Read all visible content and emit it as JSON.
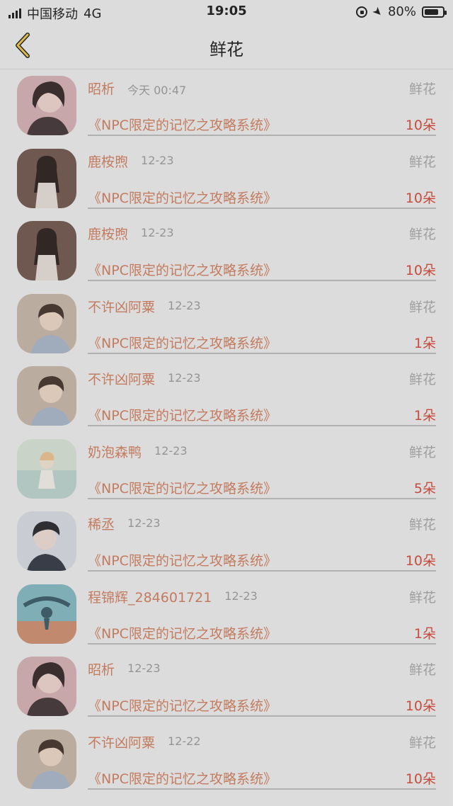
{
  "status": {
    "carrier": "中国移动",
    "network": "4G",
    "time": "19:05",
    "battery_text": "80%",
    "battery_level": 0.8
  },
  "nav": {
    "title": "鲜花",
    "back_icon": "chevron-left-icon"
  },
  "colors": {
    "accent": "#d27b58",
    "count": "#d6412f",
    "muted": "#a7a7a7"
  },
  "rows": [
    {
      "name": "昭析",
      "date": "今天 00:47",
      "type": "鲜花",
      "book": "《NPC限定的记忆之攻略系统》",
      "count": "10朵",
      "avatar": "avatar-a"
    },
    {
      "name": "鹿桉煦",
      "date": "12-23",
      "type": "鲜花",
      "book": "《NPC限定的记忆之攻略系统》",
      "count": "10朵",
      "avatar": "avatar-b"
    },
    {
      "name": "鹿桉煦",
      "date": "12-23",
      "type": "鲜花",
      "book": "《NPC限定的记忆之攻略系统》",
      "count": "10朵",
      "avatar": "avatar-b"
    },
    {
      "name": "不许凶阿粟",
      "date": "12-23",
      "type": "鲜花",
      "book": "《NPC限定的记忆之攻略系统》",
      "count": "1朵",
      "avatar": "avatar-c"
    },
    {
      "name": "不许凶阿粟",
      "date": "12-23",
      "type": "鲜花",
      "book": "《NPC限定的记忆之攻略系统》",
      "count": "1朵",
      "avatar": "avatar-c"
    },
    {
      "name": "奶泡森鸭",
      "date": "12-23",
      "type": "鲜花",
      "book": "《NPC限定的记忆之攻略系统》",
      "count": "5朵",
      "avatar": "avatar-d"
    },
    {
      "name": "稀丞",
      "date": "12-23",
      "type": "鲜花",
      "book": "《NPC限定的记忆之攻略系统》",
      "count": "10朵",
      "avatar": "avatar-e"
    },
    {
      "name": "程锦辉_284601721",
      "date": "12-23",
      "type": "鲜花",
      "book": "《NPC限定的记忆之攻略系统》",
      "count": "1朵",
      "avatar": "avatar-f"
    },
    {
      "name": "昭析",
      "date": "12-23",
      "type": "鲜花",
      "book": "《NPC限定的记忆之攻略系统》",
      "count": "10朵",
      "avatar": "avatar-a"
    },
    {
      "name": "不许凶阿粟",
      "date": "12-22",
      "type": "鲜花",
      "book": "《NPC限定的记忆之攻略系统》",
      "count": "10朵",
      "avatar": "avatar-c"
    }
  ]
}
